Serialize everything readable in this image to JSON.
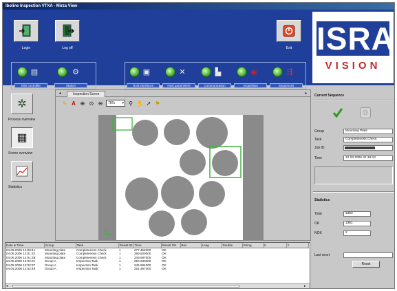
{
  "window": {
    "title": "Iboline Inspection VTXA - Mirza View"
  },
  "toolbar": {
    "login_label": "Login",
    "logoff_label": "Log off",
    "exit_label": "Exit",
    "group_left": [
      {
        "label": "Mini controller",
        "icon": "printer-icon"
      },
      {
        "label": "Station",
        "icon": "gears-icon"
      }
    ],
    "group_right": [
      {
        "label": "Host interfaces",
        "icon": "computer-icon"
      },
      {
        "label": "Host parameters",
        "icon": "tools-icon"
      },
      {
        "label": "Communication",
        "icon": "network-icon"
      },
      {
        "label": "Acquisition",
        "icon": "camera-icon"
      },
      {
        "label": "Sequences",
        "icon": "sequence-icon"
      }
    ]
  },
  "logo": {
    "text": "ISRA",
    "subtext": "VISION"
  },
  "sidebar": {
    "items": [
      {
        "label": "Process overview",
        "icon": "process-icon"
      },
      {
        "label": "Scene overview",
        "icon": "scene-icon"
      },
      {
        "label": "Statistics",
        "icon": "chart-icon"
      }
    ]
  },
  "scene": {
    "tab_label": "Inspection Scene",
    "zoom_value": "76%"
  },
  "current_sequence": {
    "title": "Current Sequence",
    "group_label": "Group",
    "group_value": "Mounting Plate",
    "task_label": "Task",
    "task_value": "Completeness Check",
    "jobid_label": "Job ID",
    "jobid_progress": 0.65,
    "time_label": "Time",
    "time_value": "12.03.2006 21:19:12"
  },
  "statistics": {
    "title": "Statistics",
    "total_label": "Total",
    "total_value": "1363",
    "ok_label": "OK",
    "ok_value": "1361",
    "nok_label": "NOK",
    "nok_value": "2",
    "last_reset_label": "Last reset",
    "reset_label": "Reset"
  },
  "log": {
    "columns": [
      "Date & Time",
      "Group",
      "Task",
      "Result ID",
      "Time",
      "Result OK",
      "Box",
      "Long",
      "Double",
      "String",
      "X",
      "Y"
    ],
    "rows": [
      [
        "04.05.2006 12:00:41",
        "Mounting plate",
        "Completeness Check",
        "1",
        "277.453000",
        "OK"
      ],
      [
        "04.05.2006 12:01:32",
        "Mounting plate",
        "Completeness Check",
        "1",
        "259.500000",
        "OK"
      ],
      [
        "04.05.2006 12:01:38",
        "Mounting plate",
        "Completeness Check",
        "1",
        "249.597000",
        "OK"
      ],
      [
        "04.05.2006 12:02:31",
        "Group A",
        "Inspection Task",
        "1",
        "250.230000",
        "OK"
      ],
      [
        "04.05.2006 12:02:37",
        "Group A",
        "Inspection Task",
        "1",
        "245.604000",
        "OK"
      ],
      [
        "04.05.2006 12:02:48",
        "Group A",
        "Inspection Task",
        "1",
        "251.497300",
        "OK"
      ]
    ]
  },
  "colors": {
    "header_blue": "#1f3f9a",
    "ok_green": "#2f9a1e",
    "logo_red": "#c0282d",
    "roi_green": "#3cb43c"
  }
}
